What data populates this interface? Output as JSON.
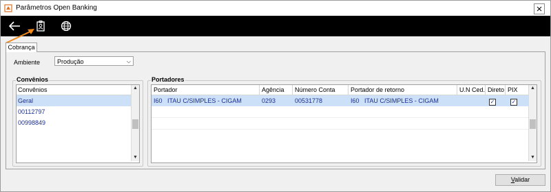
{
  "window": {
    "title": "Parâmetros Open Banking"
  },
  "toolbar": {
    "back_icon": "arrow-left-icon",
    "badge_icon": "id-badge-icon",
    "globe_icon": "globe-icon"
  },
  "tabs": [
    {
      "label": "Cobrança"
    }
  ],
  "ambiente": {
    "label": "Ambiente",
    "value": "Produção"
  },
  "convenios": {
    "group_title": "Convênios",
    "column": "Convênios",
    "items": [
      "Geral",
      "00112797",
      "00998849"
    ]
  },
  "portadores": {
    "group_title": "Portadores",
    "columns": [
      "Portador",
      "Agência",
      "Número Conta",
      "Portador de retorno",
      "U.N Ced.",
      "Direto",
      "PIX"
    ],
    "rows": [
      {
        "portador": "I60   ITAU C/SIMPLES - CIGAM",
        "agencia": "0293",
        "conta": "00531778",
        "retorno": "I60   ITAU C/SIMPLES - CIGAM",
        "un_ced": "",
        "direto": true,
        "pix": true
      }
    ]
  },
  "footer": {
    "validar_label": "Validar",
    "validar_accel": "V",
    "validar_rest": "alidar"
  },
  "colors": {
    "toolbar_bg": "#000000",
    "selected_row": "#cce0f7",
    "accent_arrow": "#f08a1c",
    "link_blue": "#1c2f8c"
  }
}
